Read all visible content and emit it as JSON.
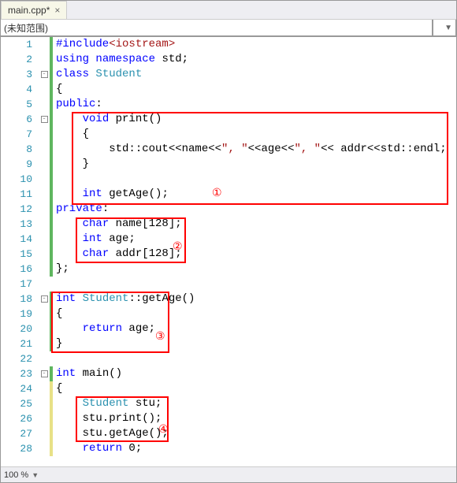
{
  "tab": {
    "title": "main.cpp*",
    "close": "×"
  },
  "scope": {
    "label": "(未知范围)"
  },
  "status": {
    "zoom": "100 %"
  },
  "annotations": {
    "a1": "①",
    "a2": "②",
    "a3": "③",
    "a4": "④"
  },
  "code": {
    "l1": {
      "num": "1",
      "t1": "#include",
      "t2": "<iostream>"
    },
    "l2": {
      "num": "2",
      "t1": "using",
      "t2": " ",
      "t3": "namespace",
      "t4": " std;"
    },
    "l3": {
      "num": "3",
      "t1": "class",
      "t2": " ",
      "t3": "Student"
    },
    "l4": {
      "num": "4",
      "t1": "{"
    },
    "l5": {
      "num": "5",
      "t1": "public",
      "t2": ":"
    },
    "l6": {
      "num": "6",
      "t1": "    ",
      "t2": "void",
      "t3": " print()"
    },
    "l7": {
      "num": "7",
      "t1": "    {"
    },
    "l8": {
      "num": "8",
      "t1": "        std::cout<<name<<",
      "t2": "\", \"",
      "t3": "<<age<<",
      "t4": "\", \"",
      "t5": "<< addr<<std::endl;"
    },
    "l9": {
      "num": "9",
      "t1": "    }"
    },
    "l10": {
      "num": "10",
      "t1": ""
    },
    "l11": {
      "num": "11",
      "t1": "    ",
      "t2": "int",
      "t3": " getAge();"
    },
    "l12": {
      "num": "12",
      "t1": "private",
      "t2": ":"
    },
    "l13": {
      "num": "13",
      "t1": "    ",
      "t2": "char",
      "t3": " name[128];"
    },
    "l14": {
      "num": "14",
      "t1": "    ",
      "t2": "int",
      "t3": " age;"
    },
    "l15": {
      "num": "15",
      "t1": "    ",
      "t2": "char",
      "t3": " addr[128];"
    },
    "l16": {
      "num": "16",
      "t1": "};"
    },
    "l17": {
      "num": "17",
      "t1": ""
    },
    "l18": {
      "num": "18",
      "t1": "int",
      "t2": " ",
      "t3": "Student",
      "t4": "::getAge()"
    },
    "l19": {
      "num": "19",
      "t1": "{"
    },
    "l20": {
      "num": "20",
      "t1": "    ",
      "t2": "return",
      "t3": " age;"
    },
    "l21": {
      "num": "21",
      "t1": "}"
    },
    "l22": {
      "num": "22",
      "t1": ""
    },
    "l23": {
      "num": "23",
      "t1": "int",
      "t2": " main()"
    },
    "l24": {
      "num": "24",
      "t1": "{"
    },
    "l25": {
      "num": "25",
      "t1": "    ",
      "t2": "Student",
      "t3": " stu;"
    },
    "l26": {
      "num": "26",
      "t1": "    stu.print();"
    },
    "l27": {
      "num": "27",
      "t1": "    stu.getAge();"
    },
    "l28": {
      "num": "28",
      "t1": "    ",
      "t2": "return",
      "t3": " 0;"
    }
  }
}
